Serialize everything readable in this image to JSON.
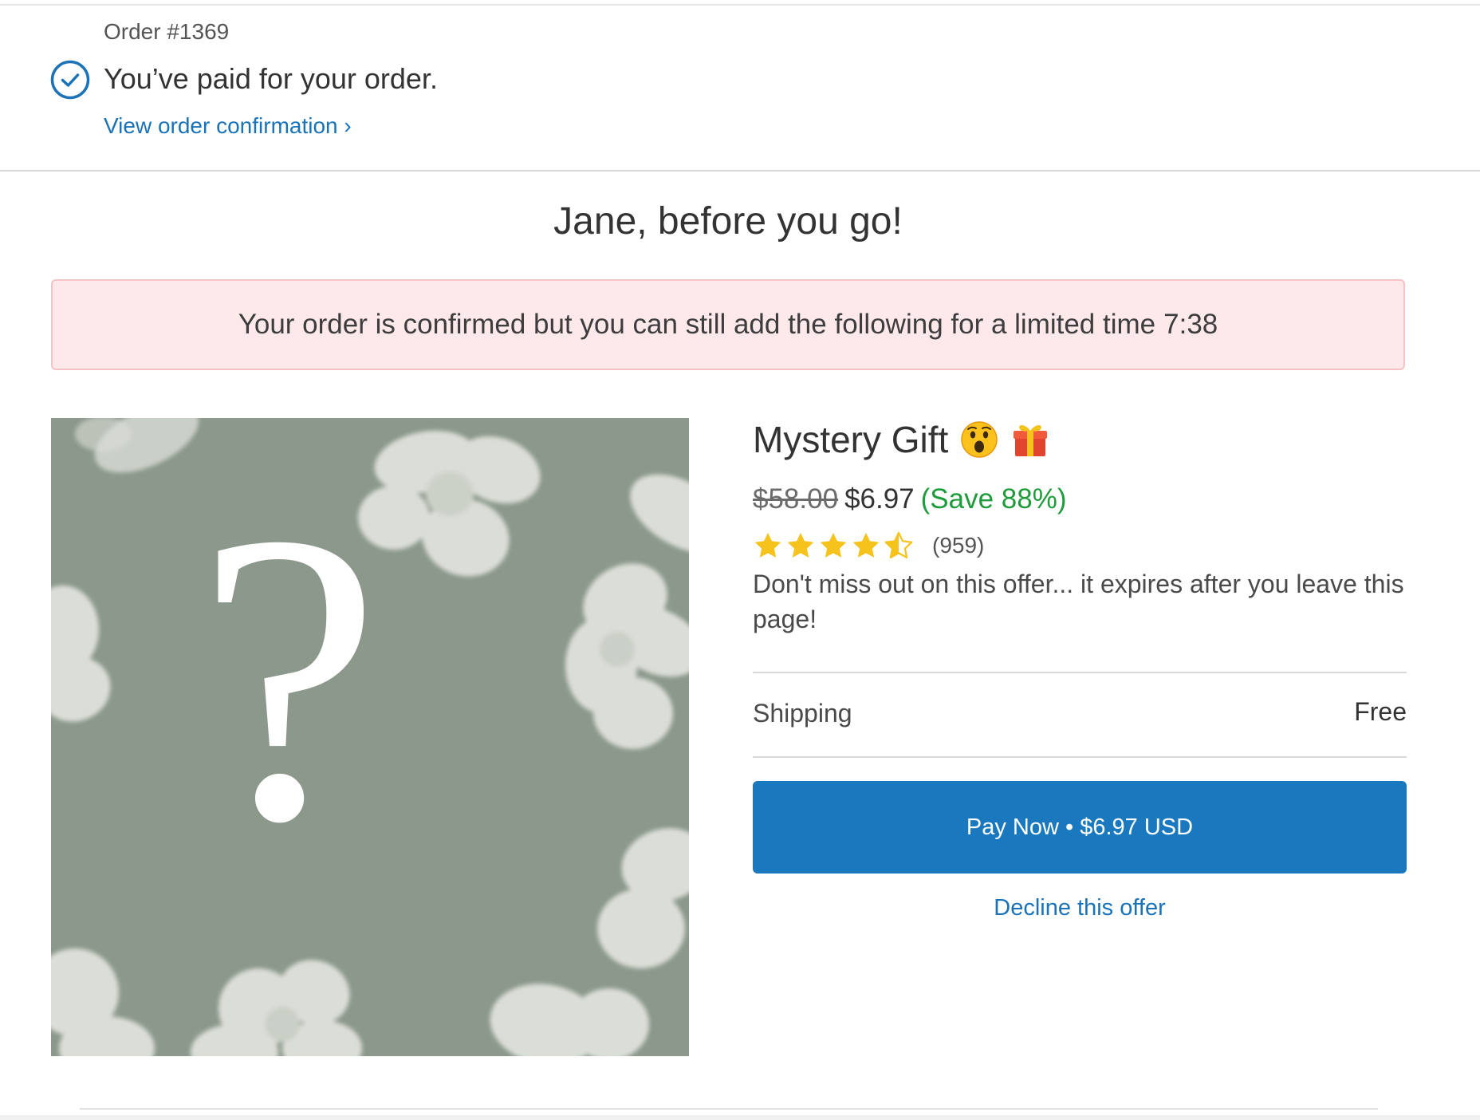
{
  "order": {
    "number_label": "Order #1369",
    "status_text": "You’ve paid for your order.",
    "view_link": "View order confirmation ›"
  },
  "headline": "Jane, before you go!",
  "banner": {
    "message": "Your order is confirmed but you can still add the following for a limited time",
    "timer": "7:38"
  },
  "product": {
    "image_glyph": "?",
    "title": "Mystery Gift",
    "emojis": [
      "astonished-face-icon",
      "gift-icon"
    ],
    "original_price": "$58.00",
    "price": "$6.97",
    "savings": "(Save 88%)",
    "rating": 4.5,
    "rating_max": 5,
    "review_count": "(959)",
    "description": "Don't miss out on this offer... it expires after you leave this page!"
  },
  "shipping": {
    "label": "Shipping",
    "value": "Free"
  },
  "actions": {
    "pay_label": "Pay Now • $6.97 USD",
    "decline_label": "Decline this offer"
  },
  "colors": {
    "accent": "#1a78be",
    "link": "#1a73b8",
    "save_green": "#1e9c3c",
    "banner_bg": "#fde8ea",
    "banner_border": "#f5c2c7",
    "image_bg": "#8c988b",
    "star": "#f6c21c"
  }
}
